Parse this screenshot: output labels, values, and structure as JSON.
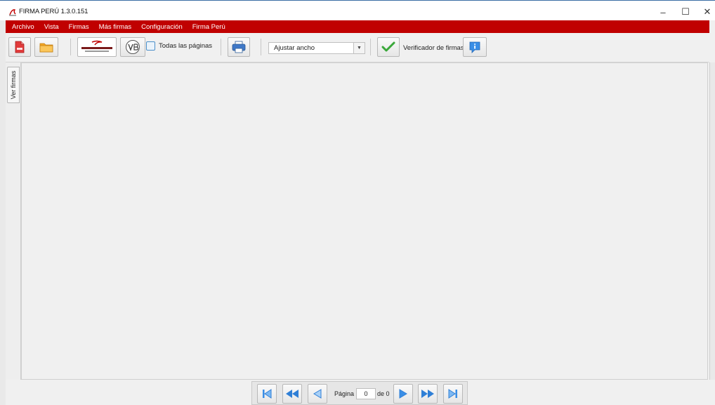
{
  "window": {
    "title": "FIRMA PERÚ 1.3.0.151",
    "controls": {
      "minimize": "–",
      "maximize": "☐",
      "close": "✕"
    }
  },
  "menu": {
    "items": [
      "Archivo",
      "Vista",
      "Firmas",
      "Más firmas",
      "Configuración",
      "Firma Perú"
    ]
  },
  "toolbar": {
    "all_pages_label": "Todas las páginas",
    "all_pages_checked": false,
    "zoom_value": "Ajustar ancho",
    "verifier_label": "Verificador de firmas",
    "icons": [
      "pdf-file-icon",
      "folder-open-icon",
      "contraloria-logo",
      "vb-stamp-icon",
      "printer-icon",
      "checkmark-icon",
      "info-icon"
    ]
  },
  "side_panel": {
    "tab_label": "Ver firmas"
  },
  "navigation": {
    "page_label": "Página",
    "current_page": "0",
    "of_label": "de 0"
  },
  "colors": {
    "menu_bar": "#c00000",
    "accent_blue": "#2f7fd6",
    "check_green": "#3aa83a"
  }
}
